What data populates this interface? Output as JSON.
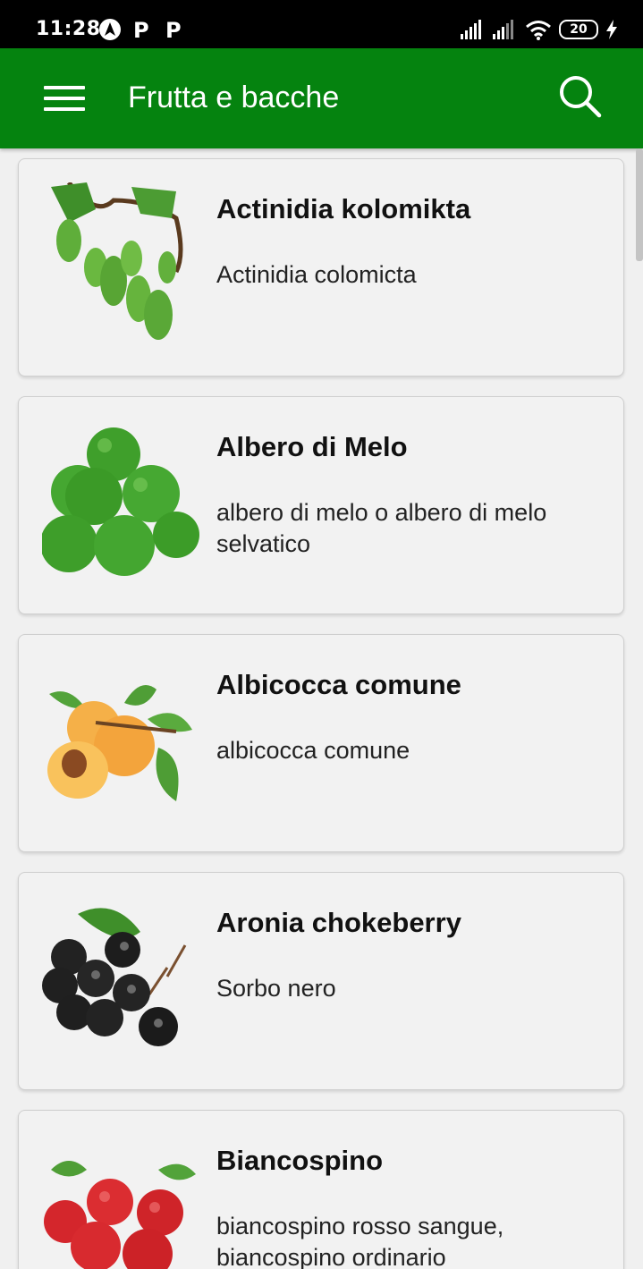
{
  "status_bar": {
    "time": "11:28",
    "battery": "20",
    "icons": [
      "navigation-a-icon",
      "parking-p-icon",
      "parking-p-icon",
      "signal-icon",
      "signal-icon",
      "wifi-icon",
      "battery-icon",
      "charging-icon"
    ]
  },
  "app_bar": {
    "title": "Frutta e bacche",
    "background": "#05830f",
    "menu_icon": "menu-icon",
    "search_icon": "search-icon"
  },
  "items": [
    {
      "title": "Actinidia kolomikta",
      "subtitle": "Actinidia colomicta",
      "image_icon": "kiwi-berry-icon"
    },
    {
      "title": "Albero di Melo",
      "subtitle": "albero di melo o albero di melo selvatico",
      "image_icon": "green-apple-icon"
    },
    {
      "title": "Albicocca comune",
      "subtitle": "albicocca comune",
      "image_icon": "apricot-icon"
    },
    {
      "title": "Aronia chokeberry",
      "subtitle": "Sorbo nero",
      "image_icon": "chokeberry-icon"
    },
    {
      "title": "Biancospino",
      "subtitle": "biancospino rosso sangue, biancospino ordinario",
      "image_icon": "hawthorn-icon"
    }
  ]
}
